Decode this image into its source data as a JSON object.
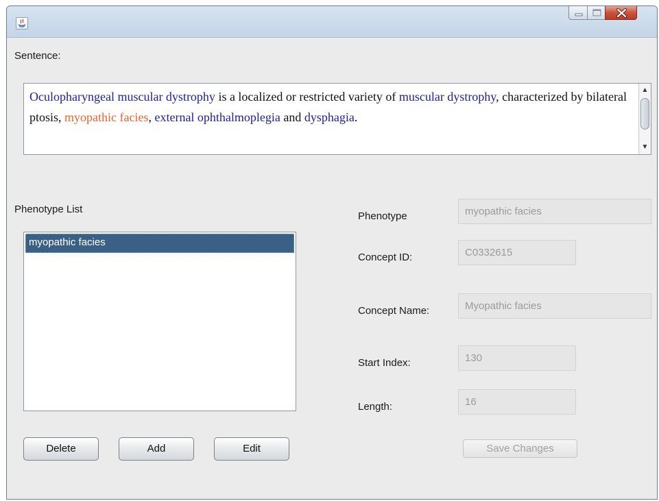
{
  "window": {
    "title": "",
    "controls": [
      "minimize-icon",
      "maximize-icon",
      "close-icon"
    ]
  },
  "sentence": {
    "label": "Sentence:",
    "segments": [
      {
        "text": "Oculopharyngeal muscular dystrophy",
        "type": "concept"
      },
      {
        "text": " is a localized or restricted variety of ",
        "type": "plain"
      },
      {
        "text": "muscular dystrophy",
        "type": "concept"
      },
      {
        "text": ", characterized by bilateral ptosis, ",
        "type": "plain"
      },
      {
        "text": "myopathic facies",
        "type": "highlight"
      },
      {
        "text": ", ",
        "type": "plain"
      },
      {
        "text": "external ophthalmoplegia",
        "type": "concept"
      },
      {
        "text": " and ",
        "type": "plain"
      },
      {
        "text": "dysphagia",
        "type": "concept"
      },
      {
        "text": ".",
        "type": "plain"
      }
    ],
    "colors": {
      "concept": "#1e1e9c",
      "highlight": "#f0622a",
      "plain": "#111111"
    }
  },
  "phenotype_list": {
    "label": "Phenotype List",
    "items": [
      "myopathic facies"
    ],
    "selected_index": 0
  },
  "details": {
    "phenotype_label": "Phenotype",
    "phenotype_value": "myopathic facies",
    "concept_id_label": "Concept ID:",
    "concept_id_value": "C0332615",
    "concept_name_label": "Concept Name:",
    "concept_name_value": "Myopathic facies",
    "start_index_label": "Start Index:",
    "start_index_value": "130",
    "length_label": "Length:",
    "length_value": "16"
  },
  "buttons": {
    "delete": "Delete",
    "add": "Add",
    "edit": "Edit",
    "save_changes": "Save Changes"
  }
}
